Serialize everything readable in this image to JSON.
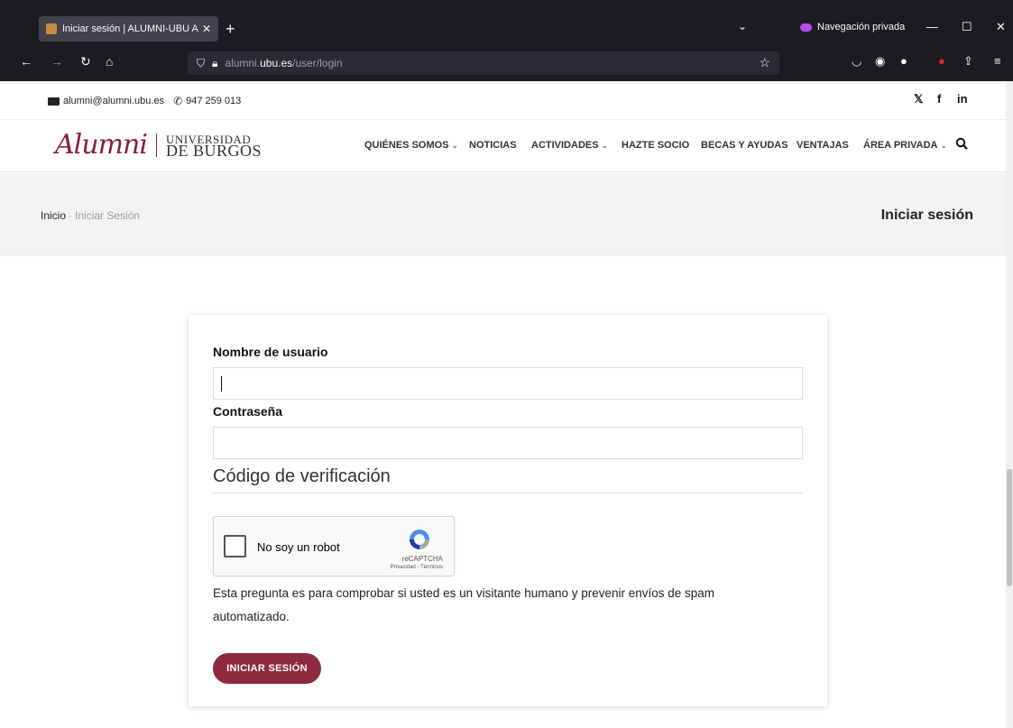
{
  "browser": {
    "tab_title": "Iniciar sesión | ALUMNI-UBU As",
    "tab_close": "✕",
    "new_tab": "+",
    "tab_list": "⌄",
    "private_label": "Navegación privada",
    "url_host": "alumni.ubu.es",
    "url_prefix": "alumni.",
    "url_path": "/user/login",
    "url_domain_bold": "ubu.es",
    "icons": [
      "back-icon",
      "forward-icon",
      "reload-icon",
      "home-icon",
      "shield-icon",
      "lock-icon",
      "bookmark-star-icon",
      "pocket-icon",
      "account-icon",
      "extension-icon",
      "addon-icon",
      "share-icon",
      "menu-icon"
    ]
  },
  "topbar": {
    "email": "alumni@alumni.ubu.es",
    "phone": "947 259 013",
    "social": {
      "x": "𝕏",
      "facebook": "f",
      "linkedin": "in"
    }
  },
  "header": {
    "logo_alumni": "Alumni",
    "logo_uni_line1": "UNIVERSIDAD",
    "logo_uni_line2": "DE BURGOS",
    "menu": [
      {
        "label": "QUIÉNES SOMOS",
        "dropdown": true
      },
      {
        "label": "NOTICIAS",
        "dropdown": false
      },
      {
        "label": "ACTIVIDADES",
        "dropdown": true
      },
      {
        "label": "HAZTE SOCIO",
        "dropdown": false
      },
      {
        "label": "BECAS Y AYUDAS",
        "dropdown": false
      },
      {
        "label": "VENTAJAS",
        "dropdown": false
      },
      {
        "label": "ÁREA PRIVADA",
        "dropdown": true
      }
    ],
    "caret": "⌄"
  },
  "banner": {
    "crumb_home": "Inicio",
    "crumb_sep": "·",
    "crumb_current": "Iniciar Sesión",
    "title": "Iniciar sesión"
  },
  "form": {
    "username_label": "Nombre de usuario",
    "username_value": "",
    "password_label": "Contraseña",
    "password_value": "",
    "captcha_section": "Código de verificación",
    "captcha_checkbox": "No soy un robot",
    "captcha_brand": "reCAPTCHA",
    "captcha_terms": "Privacidad - Términos",
    "help_text": "Esta pregunta es para comprobar si usted es un visitante humano y prevenir envíos de spam automatizado.",
    "submit_label": "INICIAR SESIÓN"
  },
  "colors": {
    "brand": "#8b1e3f",
    "button": "#8e2a3e",
    "chrome_bg": "#1c1b22",
    "private_accent": "#b64cf5"
  }
}
